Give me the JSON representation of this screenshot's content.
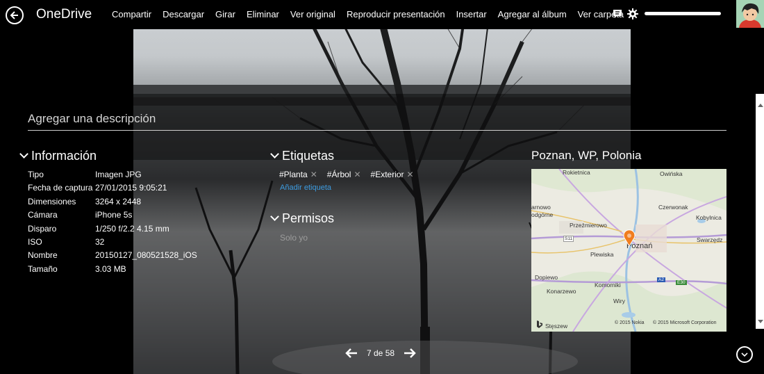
{
  "app": {
    "title": "OneDrive"
  },
  "toolbar": {
    "items": [
      "Compartir",
      "Descargar",
      "Girar",
      "Eliminar",
      "Ver original",
      "Reproducir presentación",
      "Insertar",
      "Agregar al álbum",
      "Ver carpeta"
    ]
  },
  "user": {
    "name": ""
  },
  "description": {
    "placeholder": "Agregar una descripción"
  },
  "info": {
    "heading": "Información",
    "rows": [
      {
        "label": "Tipo",
        "value": "Imagen JPG"
      },
      {
        "label": "Fecha de captura",
        "value": "27/01/2015 9:05:21"
      },
      {
        "label": "Dimensiones",
        "value": "3264 x 2448"
      },
      {
        "label": "Cámara",
        "value": "iPhone 5s"
      },
      {
        "label": "Disparo",
        "value": "1/250 f/2.2 4.15 mm"
      },
      {
        "label": "ISO",
        "value": "32"
      },
      {
        "label": "Nombre",
        "value": "20150127_080521528_iOS"
      },
      {
        "label": "Tamaño",
        "value": "3.03 MB"
      }
    ]
  },
  "tags": {
    "heading": "Etiquetas",
    "items": [
      "#Planta",
      "#Árbol",
      "#Exterior"
    ],
    "add_label": "Añadir etiqueta"
  },
  "permissions": {
    "heading": "Permisos",
    "value": "Solo yo"
  },
  "location": {
    "title": "Poznan, WP, Polonia",
    "map_labels": [
      "Rokietnica",
      "Owińska",
      "arnowo",
      "odgórne",
      "Czerwonak",
      "Kobylnica",
      "Przeźmierowo",
      "Poznań",
      "Swarzędz",
      "S11",
      "Plewiska",
      "Dopiewo",
      "Komorniki",
      "Konarzewo",
      "Wiry",
      "A2",
      "E30",
      "Stęszew"
    ],
    "copyright_nokia": "© 2015 Nokia",
    "copyright_ms": "© 2015 Microsoft Corporation"
  },
  "pager": {
    "text": "7 de 58"
  },
  "colors": {
    "accent_link": "#3c9be0",
    "map_pin": "#f07d1e"
  }
}
